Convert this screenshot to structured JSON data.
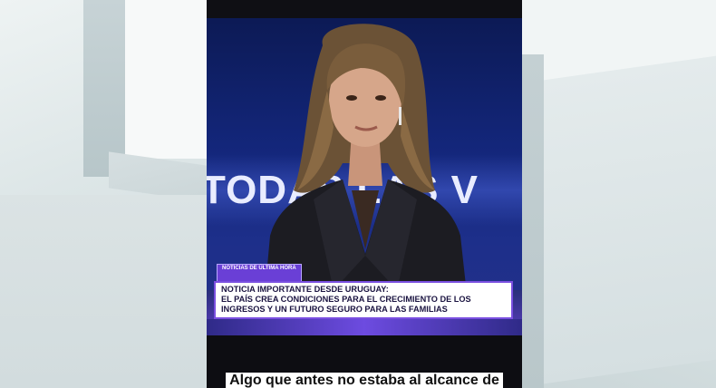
{
  "studio_wall_text": "TODAS LAS V",
  "lower_third": {
    "tag": "NOTICIAS DE ÚLTIMA HORA",
    "headline": "NOTICIA IMPORTANTE DESDE URUGUAY:",
    "body_line1": "EL PAÍS CREA CONDICIONES PARA EL CRECIMIENTO DE LOS",
    "body_line2": "INGRESOS Y UN FUTURO SEGURO PARA LAS FAMILIAS"
  },
  "subtitle": "Algo que antes no estaba al alcance de",
  "colors": {
    "studio_blue": "#13267a",
    "accent_purple": "#6a3fd6",
    "lower_third_bg": "#ffffff"
  }
}
